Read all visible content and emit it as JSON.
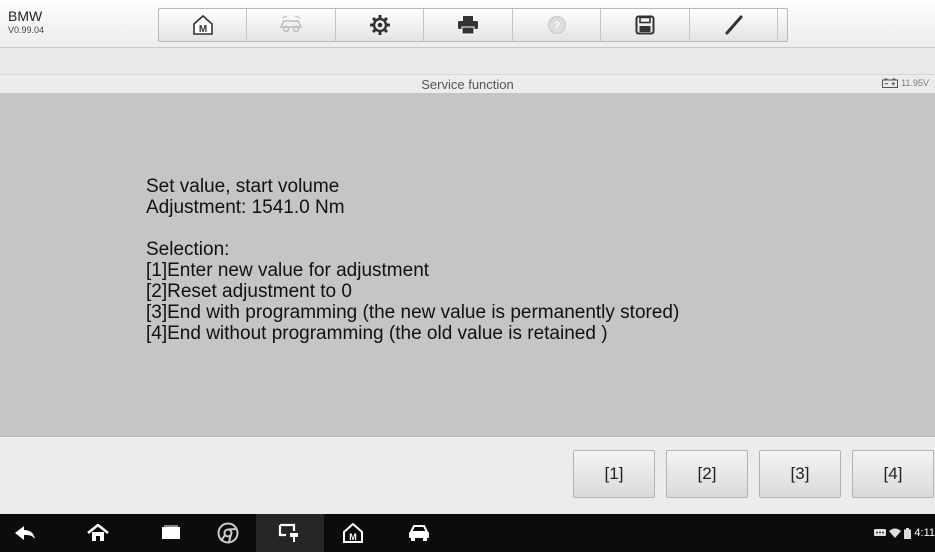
{
  "app": {
    "brand": "BMW",
    "version": "V0.99.04"
  },
  "toolbar": {
    "buttons": [
      {
        "icon": "home-icon"
      },
      {
        "icon": "vehicle-swap-icon"
      },
      {
        "icon": "settings-gear-icon"
      },
      {
        "icon": "print-icon"
      },
      {
        "icon": "help-icon"
      },
      {
        "icon": "save-icon"
      },
      {
        "icon": "pen-icon"
      }
    ]
  },
  "titlebar": {
    "title": "Service function",
    "battery_voltage": "11.95V"
  },
  "message": {
    "line1": "Set value, start volume",
    "line2": "Adjustment: 1541.0 Nm",
    "selection_header": "Selection:",
    "options": [
      "[1]Enter new value for adjustment",
      "[2]Reset adjustment to 0",
      "[3]End with programming (the new value is permanently stored)",
      "[4]End without programming (the old value is retained )"
    ]
  },
  "buttons": [
    "[1]",
    "[2]",
    "[3]",
    "[4]"
  ],
  "navbar": {
    "icons": [
      "back-icon",
      "home-icon",
      "recent-apps-icon",
      "chrome-icon",
      "vci-connection-icon",
      "maxisys-home-icon",
      "car-icon"
    ],
    "time": "4:11"
  },
  "colors": {
    "content_bg": "#c5c5c5",
    "topbar_bg": "#f5f5f5",
    "navbar_bg": "#0c0c0c"
  }
}
